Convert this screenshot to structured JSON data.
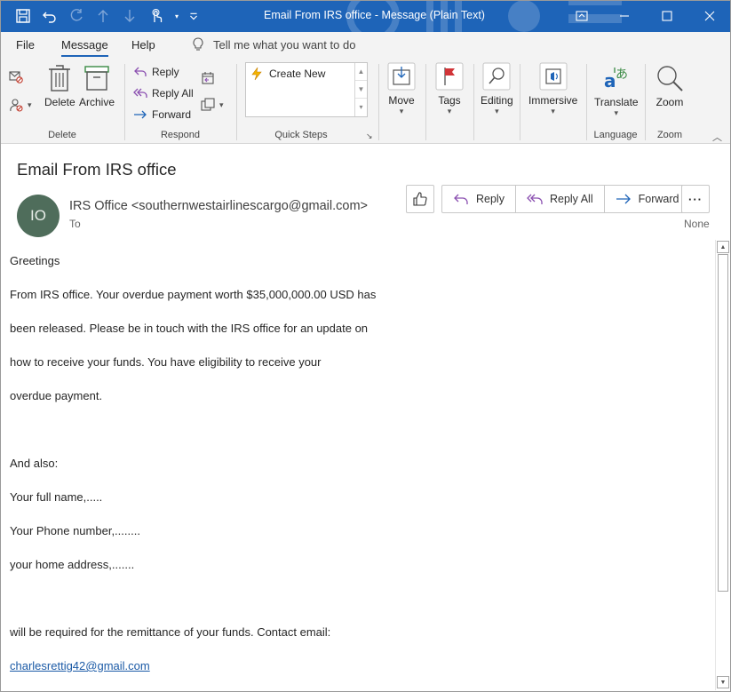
{
  "window": {
    "title": "Email From IRS office  -  Message (Plain Text)"
  },
  "menu": {
    "tabs": [
      "File",
      "Message",
      "Help"
    ],
    "active_tab": "Message",
    "tell_me": "Tell me what you want to do"
  },
  "ribbon": {
    "delete_group": {
      "label": "Delete",
      "delete_label": "Delete",
      "archive_label": "Archive"
    },
    "respond_group": {
      "label": "Respond",
      "reply_label": "Reply",
      "reply_all_label": "Reply All",
      "forward_label": "Forward"
    },
    "quick_steps_group": {
      "label": "Quick Steps",
      "create_new_label": "Create New"
    },
    "move_label": "Move",
    "tags_label": "Tags",
    "editing_label": "Editing",
    "immersive_label": "Immersive",
    "language_group": {
      "label": "Language",
      "translate_label": "Translate"
    },
    "zoom_group": {
      "label": "Zoom",
      "zoom_label": "Zoom"
    }
  },
  "message": {
    "subject": "Email From IRS office",
    "avatar_initials": "IO",
    "sender": "IRS Office <southernwestairlinescargo@gmail.com>",
    "to_label": "To",
    "reply_label": "Reply",
    "reply_all_label": "Reply All",
    "forward_label": "Forward",
    "more_label": "···",
    "category_label": "None",
    "body_lines": [
      "Greetings",
      "From IRS office. Your overdue payment worth $35,000,000.00 USD has",
      "been released. Please be in touch with the IRS office for an update on",
      "how to receive your funds. You have eligibility to receive your",
      "overdue payment.",
      "",
      "And also:",
      "Your full name,.....",
      "Your Phone number,........",
      "your home address,.......",
      "",
      "will be required for the remittance of your funds. Contact email:"
    ],
    "contact_email": "charlesrettig42@gmail.com"
  },
  "colors": {
    "titlebar": "#1e64b8",
    "avatar": "#4f6d5b",
    "link": "#1b5aa6"
  }
}
